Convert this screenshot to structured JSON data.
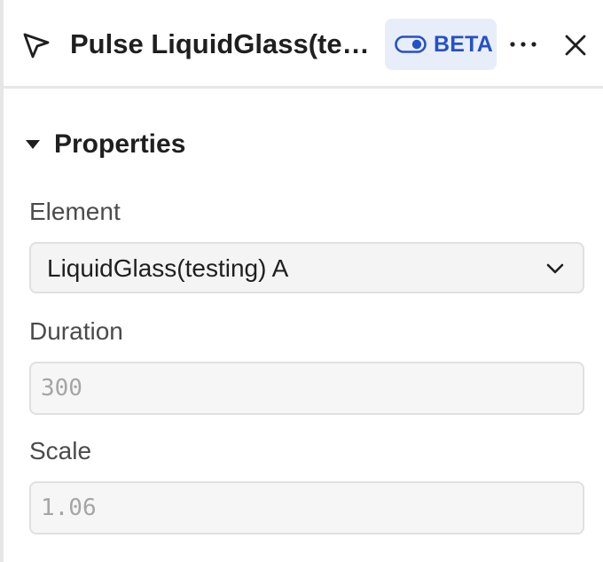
{
  "header": {
    "title": "Pulse LiquidGlass(testing) A",
    "beta_label": "BETA",
    "icons": {
      "cursor": "cursor-arrow-icon",
      "toggle": "toggle-icon",
      "more": "more-horizontal-icon",
      "close": "close-icon"
    }
  },
  "properties": {
    "section_title": "Properties",
    "expanded": true,
    "element": {
      "label": "Element",
      "value": "LiquidGlass(testing) A"
    },
    "duration": {
      "label": "Duration",
      "placeholder": "300"
    },
    "scale": {
      "label": "Scale",
      "placeholder": "1.06"
    }
  },
  "colors": {
    "accent": "#2650c9",
    "badge_background": "#e8eef9"
  }
}
